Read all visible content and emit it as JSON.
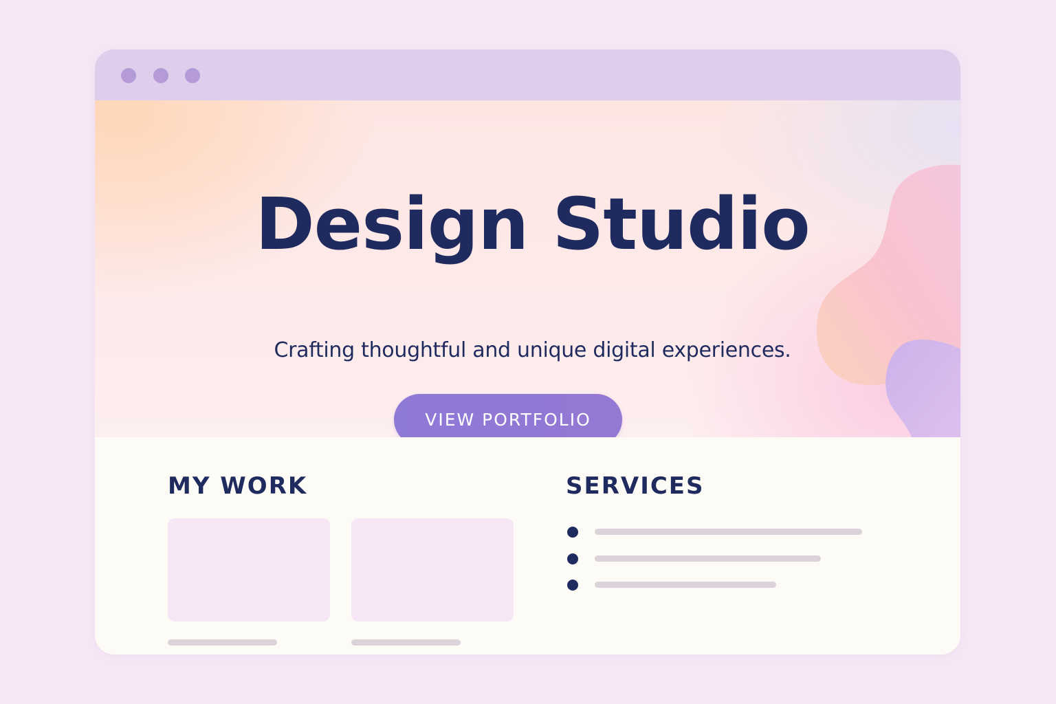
{
  "window": {
    "controls": [
      "window-dot",
      "window-dot",
      "window-dot"
    ]
  },
  "hero": {
    "title": "Design Studio",
    "subtitle": "Crafting thoughtful and unique digital experiences.",
    "cta_label": "VIEW PORTFOLIO"
  },
  "work": {
    "title": "MY WORK"
  },
  "services": {
    "title": "SERVICES"
  },
  "colors": {
    "page_background": "#f6e7f6",
    "titlebar": "#dfcdec",
    "window_dot": "#b49ad6",
    "heading_text": "#1f2a5e",
    "cta_background": "#8f79d6",
    "card_placeholder": "#f6e6f6",
    "text_placeholder": "#dcd3da",
    "content_background": "#fdfbf5"
  }
}
